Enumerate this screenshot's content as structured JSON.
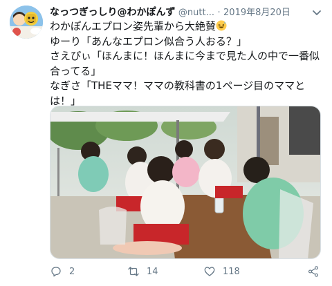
{
  "tweet": {
    "author_name": "なっつぎっしり@わかぽんず",
    "handle": "@nutt...",
    "separator": "·",
    "date": "2019年8月20日",
    "lines": [
      "わかぽんエプロン姿先輩から大絶賛",
      "ゆーり「あんなエプロン似合う人おる？」",
      "さえぴぃ「ほんまに！ほんまに今まで見た人の中で一番似合ってる」",
      "なぎさ「THEママ！ママの教科書の1ページ目のママとは！」"
    ],
    "emoji_name": "laughing-sweat-emoji"
  },
  "actions": {
    "reply_count": "2",
    "retweet_count": "14",
    "like_count": "118"
  },
  "colors": {
    "text": "#14171a",
    "secondary": "#657786",
    "border": "#d9e0e5"
  }
}
